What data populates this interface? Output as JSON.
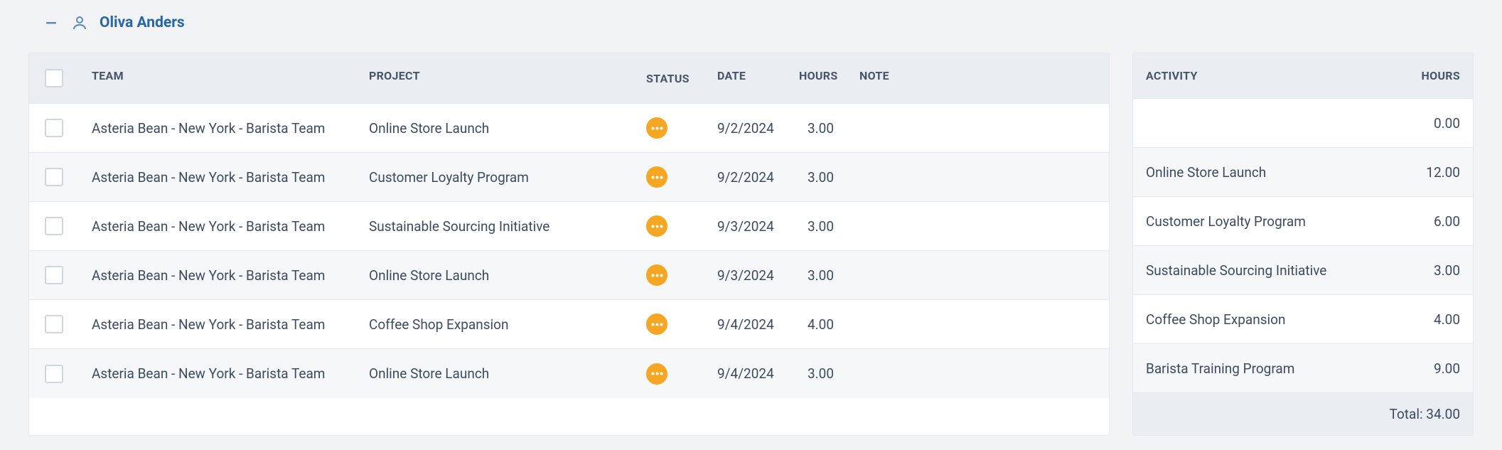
{
  "header": {
    "person_name": "Oliva Anders"
  },
  "main_table": {
    "headers": {
      "team": "Team",
      "project": "Project",
      "status": "Status",
      "date": "Date",
      "hours": "Hours",
      "note": "Note"
    },
    "rows": [
      {
        "team": "Asteria Bean - New York - Barista Team",
        "project": "Online Store Launch",
        "date": "9/2/2024",
        "hours": "3.00",
        "note": ""
      },
      {
        "team": "Asteria Bean - New York - Barista Team",
        "project": "Customer Loyalty Program",
        "date": "9/2/2024",
        "hours": "3.00",
        "note": ""
      },
      {
        "team": "Asteria Bean - New York - Barista Team",
        "project": "Sustainable Sourcing Initiative",
        "date": "9/3/2024",
        "hours": "3.00",
        "note": ""
      },
      {
        "team": "Asteria Bean - New York - Barista Team",
        "project": "Online Store Launch",
        "date": "9/3/2024",
        "hours": "3.00",
        "note": ""
      },
      {
        "team": "Asteria Bean - New York - Barista Team",
        "project": "Coffee Shop Expansion",
        "date": "9/4/2024",
        "hours": "4.00",
        "note": ""
      },
      {
        "team": "Asteria Bean - New York - Barista Team",
        "project": "Online Store Launch",
        "date": "9/4/2024",
        "hours": "3.00",
        "note": ""
      }
    ]
  },
  "side_table": {
    "headers": {
      "activity": "Activity",
      "hours": "Hours"
    },
    "rows": [
      {
        "activity": "",
        "hours": "0.00"
      },
      {
        "activity": "Online Store Launch",
        "hours": "12.00"
      },
      {
        "activity": "Customer Loyalty Program",
        "hours": "6.00"
      },
      {
        "activity": "Sustainable Sourcing Initiative",
        "hours": "3.00"
      },
      {
        "activity": "Coffee Shop Expansion",
        "hours": "4.00"
      },
      {
        "activity": "Barista Training Program",
        "hours": "9.00"
      }
    ],
    "total_label": "Total: 34.00"
  }
}
